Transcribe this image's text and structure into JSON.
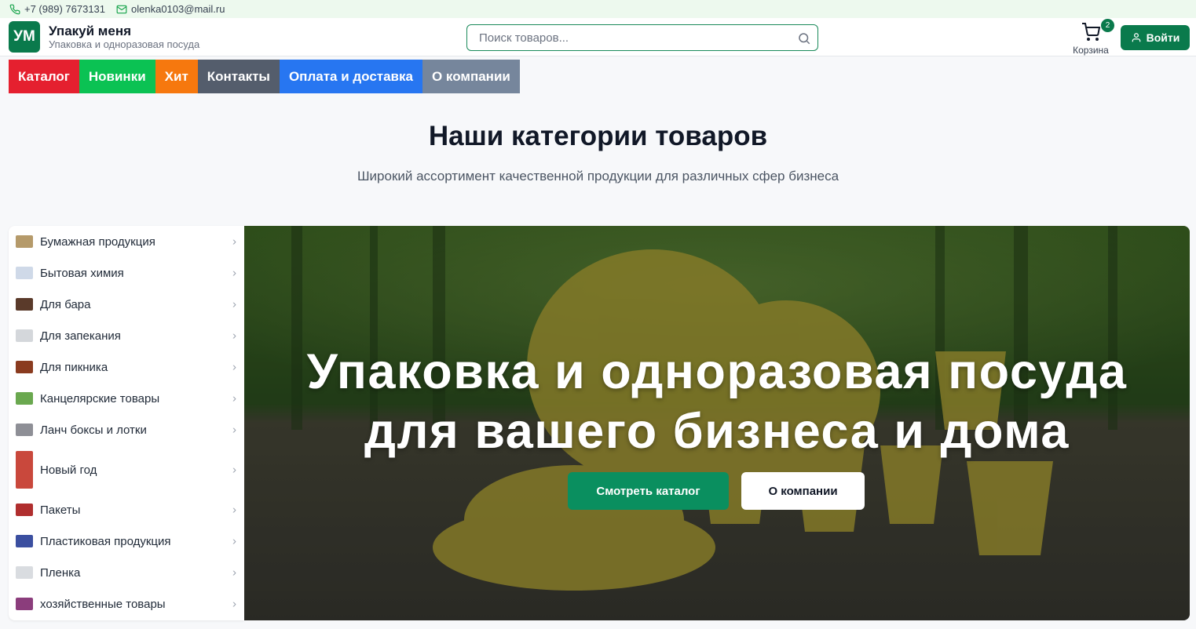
{
  "topbar": {
    "phone": "+7 (989) 7673131",
    "email": "olenka0103@mail.ru"
  },
  "header": {
    "logo_text": "УМ",
    "brand_name": "Упакуй меня",
    "brand_tagline": "Упаковка и одноразовая посуда",
    "search_placeholder": "Поиск товаров...",
    "cart_label": "Корзина",
    "cart_count": "2",
    "login_label": "Войти"
  },
  "nav": [
    {
      "label": "Каталог",
      "color": "#e5202f"
    },
    {
      "label": "Новинки",
      "color": "#0bc253"
    },
    {
      "label": "Хит",
      "color": "#f6780e"
    },
    {
      "label": "Контакты",
      "color": "#545d6c"
    },
    {
      "label": "Оплата и доставка",
      "color": "#2776f1"
    },
    {
      "label": "О компании",
      "color": "#76869c"
    }
  ],
  "section": {
    "title": "Наши категории товаров",
    "subtitle": "Широкий ассортимент качественной продукции для различных сфер бизнеса"
  },
  "categories": [
    {
      "label": "Бумажная продукция",
      "thumb": "#b59a6a"
    },
    {
      "label": "Бытовая химия",
      "thumb": "#cfd9e8"
    },
    {
      "label": "Для бара",
      "thumb": "#5a3a2a"
    },
    {
      "label": "Для запекания",
      "thumb": "#d4d7db"
    },
    {
      "label": "Для пикника",
      "thumb": "#8a3b1f"
    },
    {
      "label": "Канцелярские товары",
      "thumb": "#6aa84f"
    },
    {
      "label": "Ланч боксы и лотки",
      "thumb": "#8e8f96"
    },
    {
      "label": "Новый год",
      "thumb": "#c9483c"
    },
    {
      "label": "Пакеты",
      "thumb": "#b02e2e"
    },
    {
      "label": "Пластиковая продукция",
      "thumb": "#3b4fa0"
    },
    {
      "label": "Пленка",
      "thumb": "#d9dce0"
    },
    {
      "label": "хозяйственные товары",
      "thumb": "#8b3d7c"
    }
  ],
  "hero": {
    "title_line1": "Упаковка и одноразовая посуда",
    "title_line2": "для вашего бизнеса и дома",
    "primary_button": "Смотреть каталог",
    "secondary_button": "О компании"
  },
  "colors": {
    "brand_green": "#0a7a4c",
    "topbar_bg": "#edf9ee"
  }
}
